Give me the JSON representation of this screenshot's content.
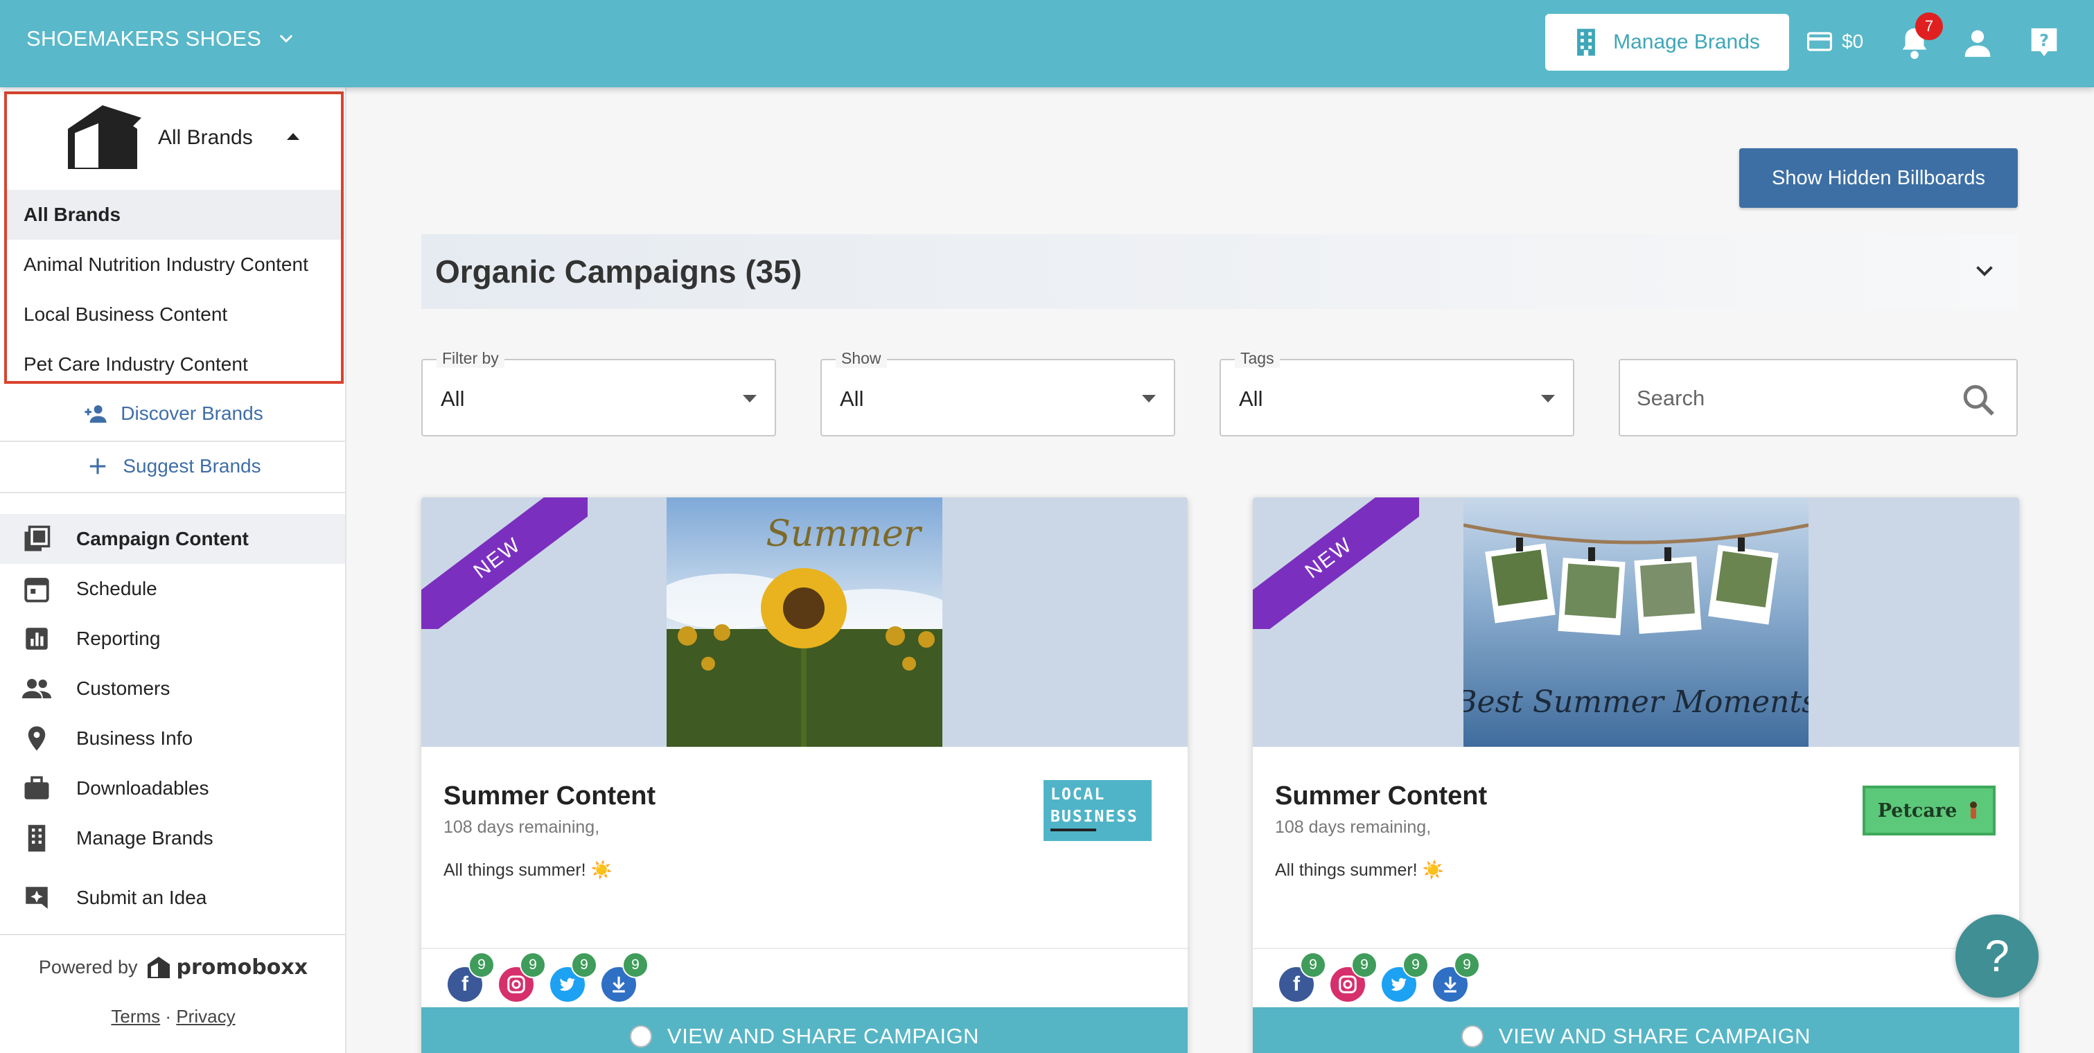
{
  "topbar": {
    "org_name": "SHOEMAKERS SHOES",
    "manage_brands_label": "Manage Brands",
    "balance": "$0",
    "notification_count": "7",
    "accent": "#59b8c9"
  },
  "brand_dropdown": {
    "selected_label": "All Brands",
    "options": [
      "All Brands",
      "Animal Nutrition Industry Content",
      "Local Business Content",
      "Pet Care Industry Content"
    ],
    "highlight_color": "#d9432f"
  },
  "sidebar": {
    "discover_label": "Discover Brands",
    "suggest_label": "Suggest Brands",
    "nav": [
      {
        "label": "Campaign Content",
        "icon": "campaign-content-icon"
      },
      {
        "label": "Schedule",
        "icon": "calendar-icon"
      },
      {
        "label": "Reporting",
        "icon": "bar-chart-icon"
      },
      {
        "label": "Customers",
        "icon": "people-icon"
      },
      {
        "label": "Business Info",
        "icon": "location-pin-icon"
      },
      {
        "label": "Downloadables",
        "icon": "briefcase-icon"
      },
      {
        "label": "Manage Brands",
        "icon": "building-icon"
      },
      {
        "label": "Submit an Idea",
        "icon": "idea-icon"
      }
    ],
    "powered_by": "Powered by",
    "powered_logo_text": "promoboxx",
    "terms_label": "Terms",
    "separator": "·",
    "privacy_label": "Privacy"
  },
  "main": {
    "show_hidden_label": "Show Hidden Billboards",
    "section_title": "Organic Campaigns (35)",
    "filters": [
      {
        "label": "Filter by",
        "value": "All"
      },
      {
        "label": "Show",
        "value": "All"
      },
      {
        "label": "Tags",
        "value": "All"
      }
    ],
    "search_placeholder": "Search",
    "cards": [
      {
        "ribbon": "NEW",
        "hero_text": "Summer",
        "title": "Summer Content",
        "remaining": "108 days remaining,",
        "description": "All things summer! ☀️",
        "brand_line1": "LOCAL",
        "brand_line2": "BUSINESS",
        "socials": [
          {
            "icon": "facebook-icon",
            "count": "9"
          },
          {
            "icon": "instagram-icon",
            "count": "9"
          },
          {
            "icon": "twitter-icon",
            "count": "9"
          },
          {
            "icon": "download-icon",
            "count": "9"
          }
        ],
        "cta": "VIEW AND SHARE CAMPAIGN"
      },
      {
        "ribbon": "NEW",
        "hero_text": "Best Summer Moments",
        "title": "Summer Content",
        "remaining": "108 days remaining,",
        "description": "All things summer! ☀️",
        "brand_line1": "Petcare",
        "socials": [
          {
            "icon": "facebook-icon",
            "count": "9"
          },
          {
            "icon": "instagram-icon",
            "count": "9"
          },
          {
            "icon": "twitter-icon",
            "count": "9"
          },
          {
            "icon": "download-icon",
            "count": "9"
          }
        ],
        "cta": "VIEW AND SHARE CAMPAIGN"
      }
    ],
    "help_fab": "?"
  }
}
